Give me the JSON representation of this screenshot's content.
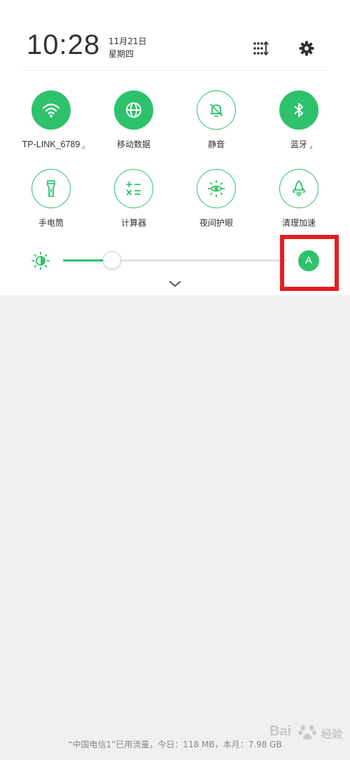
{
  "status": {
    "time": "10:28",
    "date": "11月21日",
    "weekday": "星期四"
  },
  "header": {
    "sort_icon": "sort-tiles-icon",
    "settings_icon": "gear-icon"
  },
  "tiles_row1": [
    {
      "label": "TP-LINK_6789",
      "icon": "wifi-icon",
      "state": "on",
      "has_more": true
    },
    {
      "label": "移动数据",
      "icon": "globe-icon",
      "state": "on",
      "has_more": false
    },
    {
      "label": "静音",
      "icon": "mute-bell-icon",
      "state": "off",
      "has_more": false
    },
    {
      "label": "蓝牙",
      "icon": "bluetooth-icon",
      "state": "on",
      "has_more": true
    }
  ],
  "tiles_row2": [
    {
      "label": "手电筒",
      "icon": "flashlight-icon",
      "state": "off"
    },
    {
      "label": "计算器",
      "icon": "calculator-icon",
      "state": "off"
    },
    {
      "label": "夜间护眼",
      "icon": "eye-sun-icon",
      "state": "off"
    },
    {
      "label": "清理加速",
      "icon": "rocket-icon",
      "state": "off"
    }
  ],
  "brightness": {
    "level": 0.22,
    "auto_label": "A"
  },
  "footer": {
    "text": "“中国电信1”已用流量，今日：118 MB，本月：7.98 GB"
  },
  "watermark": {
    "brand": "Bai",
    "brand_tail": "经验"
  },
  "colors": {
    "accent": "#2dc26b",
    "highlight": "#e41e23",
    "background": "#eff0f2"
  }
}
